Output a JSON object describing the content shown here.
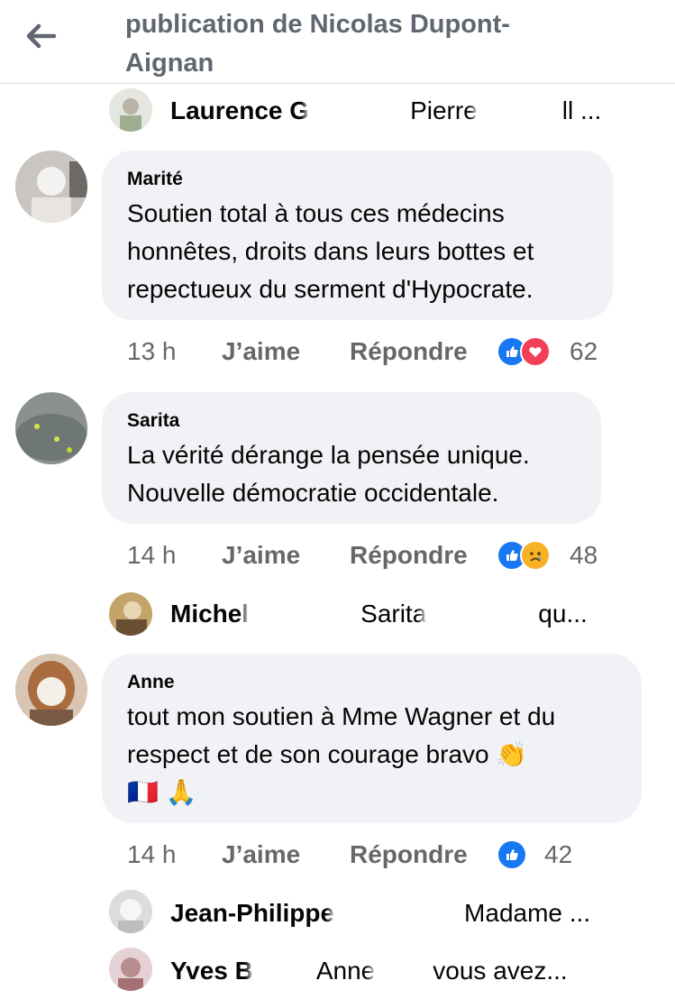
{
  "header": {
    "title": "publication de Nicolas Dupont-Aignan"
  },
  "colors": {
    "like_blue": "#1877f2",
    "love_red": "#f33e58",
    "muted": "#65676b",
    "bubble": "#f0f2f5"
  },
  "replies": [
    {
      "name": "Laurence G",
      "preview": "Pierre",
      "ellipsis": "ll ..."
    },
    {
      "name": "Michel",
      "preview": "Sarita",
      "ellipsis": "qu..."
    },
    {
      "name": "Jean-Philippe",
      "preview": "Madame ..."
    },
    {
      "name": "Yves B",
      "preview": "Anne",
      "ellipsis": "vous avez..."
    }
  ],
  "comments": [
    {
      "author": "Marité",
      "lines": [
        "Soutien total à tous ces médecins",
        "honnêtes, droits dans leurs bottes et",
        "repectueux du serment d'Hypocrate."
      ],
      "time": "13 h",
      "like": "J’aime",
      "reply": "Répondre",
      "reactions": [
        "like-icon",
        "love-icon"
      ],
      "count": "62"
    },
    {
      "author": "Sarita",
      "lines": [
        "La vérité dérange la pensée unique.",
        "Nouvelle démocratie occidentale."
      ],
      "time": "14 h",
      "like": "J’aime",
      "reply": "Répondre",
      "reactions": [
        "like-icon",
        "sad-icon"
      ],
      "count": "48"
    },
    {
      "author": "Anne",
      "lines": [
        "tout mon soutien à Mme Wagner et du",
        "respect et de son courage bravo 👏",
        "🇫🇷 🙏"
      ],
      "time": "14 h",
      "like": "J’aime",
      "reply": "Répondre",
      "reactions": [
        "like-icon"
      ],
      "count": "42"
    }
  ]
}
